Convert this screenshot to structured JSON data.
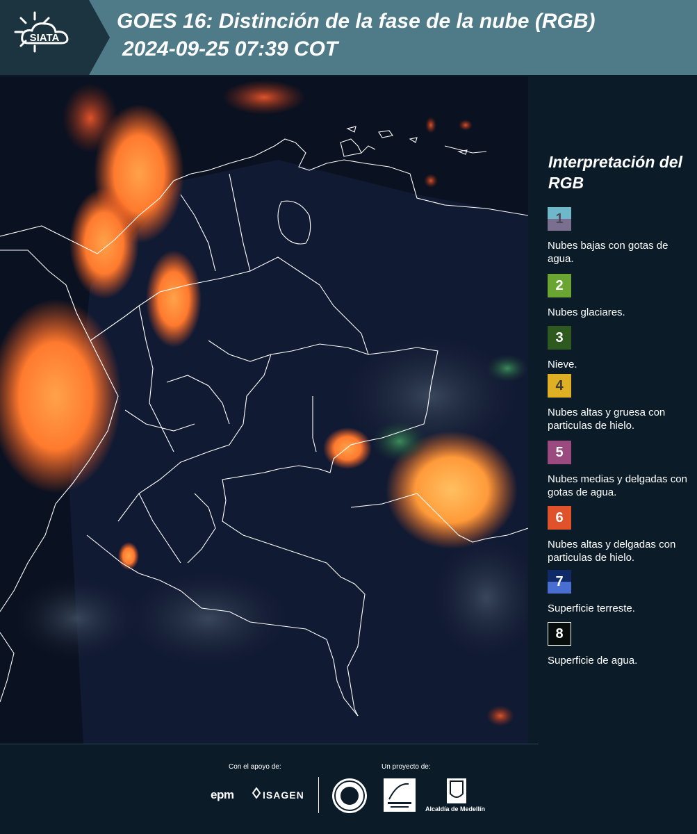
{
  "header": {
    "logo_text": "SIATA",
    "title_line1": "GOES 16: Distinción de la fase de la nube (RGB)",
    "title_line2": "2024-09-25 07:39 COT"
  },
  "legend": {
    "title": "Interpretación del RGB",
    "items": [
      {
        "number": "1",
        "label": "Nubes bajas con gotas de agua.",
        "color_top": "#6fb8c9",
        "color_bottom": "#7a6f8e",
        "number_color": "#4a4a5a"
      },
      {
        "number": "2",
        "label": "Nubes glaciares.",
        "color": "#6aa533"
      },
      {
        "number": "3",
        "label": "Nieve.",
        "color": "#2f5a1f"
      },
      {
        "number": "4",
        "label": "Nubes altas y gruesa con particulas de hielo.",
        "color": "#e0b024",
        "number_color": "#3a3a3a"
      },
      {
        "number": "5",
        "label": "Nubes medias y delgadas con gotas de agua.",
        "color": "#9a4a7e"
      },
      {
        "number": "6",
        "label": "Nubes altas y delgadas con particulas de hielo.",
        "color": "#e0532a"
      },
      {
        "number": "7",
        "label": "Superficie terreste.",
        "color_top": "#0f2a66",
        "color_bottom": "#4a6ed0"
      },
      {
        "number": "8",
        "label": "Superficie de agua.",
        "color": "#060d0a",
        "border": "#ffffff"
      }
    ]
  },
  "footer": {
    "support_label": "Con el apoyo de:",
    "project_label": "Un proyecto de:",
    "epm": "epm",
    "isagen": "ISAGEN",
    "alcaldia": "Alcaldía de Medellín"
  }
}
